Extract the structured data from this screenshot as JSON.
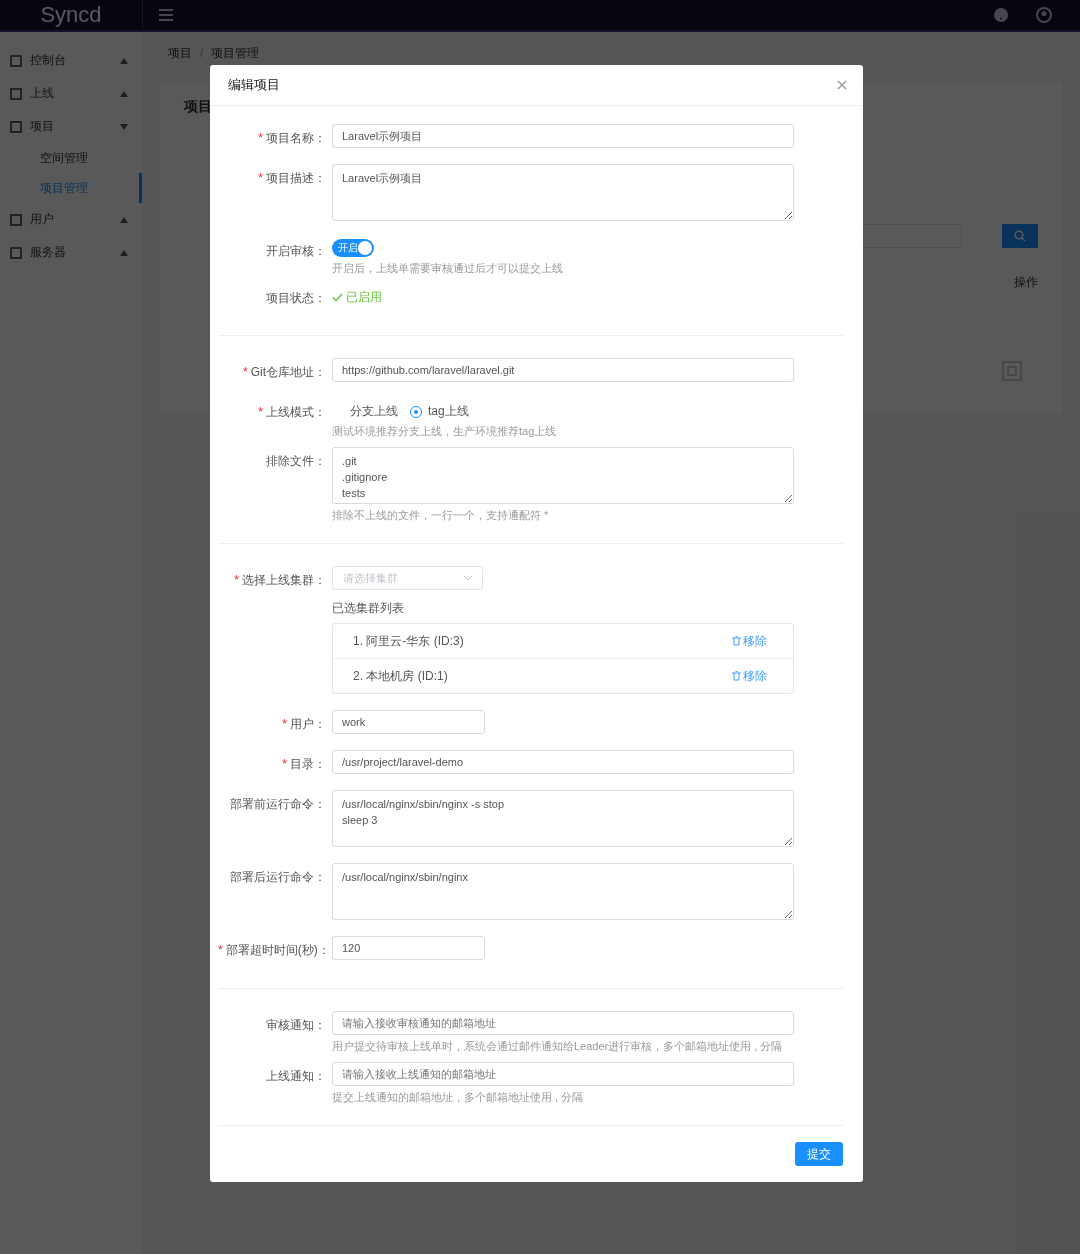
{
  "header": {
    "logo": "Syncd"
  },
  "sidebar": {
    "items": [
      {
        "label": "控制台",
        "expanded": false
      },
      {
        "label": "上线",
        "expanded": false
      },
      {
        "label": "项目",
        "expanded": true,
        "children": [
          {
            "label": "空间管理",
            "selected": false
          },
          {
            "label": "项目管理",
            "selected": true
          }
        ]
      },
      {
        "label": "用户",
        "expanded": false
      },
      {
        "label": "服务器",
        "expanded": false
      }
    ]
  },
  "breadcrumb": {
    "separator": "/",
    "items": [
      "项目",
      "项目管理"
    ]
  },
  "page": {
    "title": "项目",
    "table_action_header": "操作"
  },
  "modal": {
    "title": "编辑项目",
    "sections": [
      {
        "fields": [
          {
            "kind": "input",
            "required_mark": "*",
            "label": "项目名称：",
            "value": "Laravel示例项目"
          },
          {
            "kind": "textarea",
            "required_mark": "*",
            "label": "项目描述：",
            "value": "Laravel示例项目"
          },
          {
            "kind": "switch",
            "label": "开启审核：",
            "on": true,
            "text": "开启",
            "hint": "开启后，上线单需要审核通过后才可以提交上线"
          },
          {
            "kind": "status",
            "label": "项目状态：",
            "value": "已启用"
          }
        ]
      },
      {
        "fields": [
          {
            "kind": "input",
            "required_mark": "*",
            "label": "Git仓库地址：",
            "value": "https://github.com/laravel/laravel.git"
          },
          {
            "kind": "radio",
            "required_mark": "*",
            "label": "上线模式：",
            "options": [
              {
                "label": "分支上线",
                "selected": false
              },
              {
                "label": "tag上线",
                "selected": true
              }
            ],
            "hint": "测试环境推荐分支上线，生产环境推荐tag上线"
          },
          {
            "kind": "textarea",
            "label": "排除文件：",
            "value": ".git\n.gitignore\ntests",
            "hint": "排除不上线的文件，一行一个，支持通配符 *"
          }
        ]
      },
      {
        "fields": [
          {
            "kind": "cluster",
            "required_mark": "*",
            "label": "选择上线集群：",
            "placeholder": "请选择集群",
            "list_title": "已选集群列表",
            "clusters": [
              {
                "name": "1. 阿里云-华东 (ID:3)",
                "action": "移除"
              },
              {
                "name": "2. 本地机房 (ID:1)",
                "action": "移除"
              }
            ]
          },
          {
            "kind": "short",
            "required_mark": "*",
            "label": "用户：",
            "value": "work"
          },
          {
            "kind": "input",
            "required_mark": "*",
            "label": "目录：",
            "value": "/usr/project/laravel-demo"
          },
          {
            "kind": "textarea",
            "label": "部署前运行命令：",
            "value": "/usr/local/nginx/sbin/nginx -s stop\nsleep 3"
          },
          {
            "kind": "textarea",
            "label": "部署后运行命令：",
            "value": "/usr/local/nginx/sbin/nginx"
          },
          {
            "kind": "short",
            "required_mark": "*",
            "label": "部署超时时间(秒)：",
            "value": "120"
          }
        ]
      },
      {
        "fields": [
          {
            "kind": "input",
            "label": "审核通知：",
            "placeholder": "请输入接收审核通知的邮箱地址",
            "hint": "用户提交待审核上线单时，系统会通过邮件通知给Leader进行审核，多个邮箱地址使用 , 分隔"
          },
          {
            "kind": "input",
            "label": "上线通知：",
            "placeholder": "请输入接收上线通知的邮箱地址",
            "hint": "提交上线通知的邮箱地址，多个邮箱地址使用 , 分隔"
          }
        ]
      }
    ],
    "submit": "提交"
  }
}
